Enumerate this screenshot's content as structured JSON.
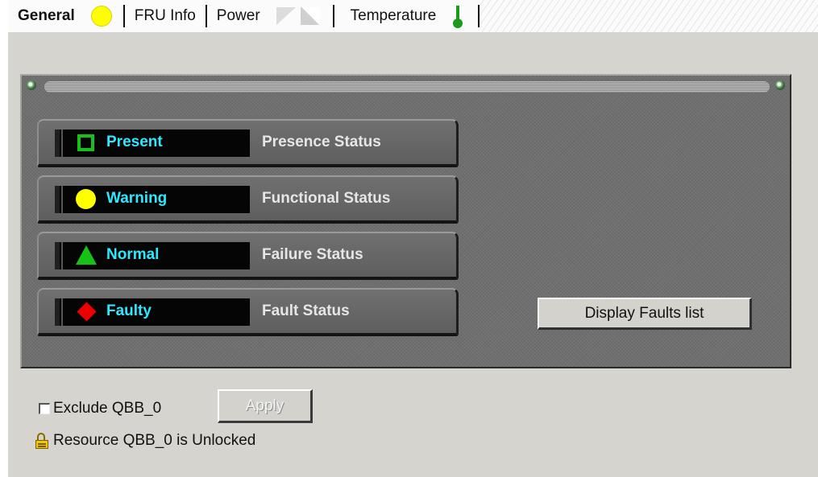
{
  "tabs": [
    {
      "label": "General",
      "icon": "status-warning-circle-icon",
      "active": true
    },
    {
      "label": "FRU Info"
    },
    {
      "label": "Power",
      "icon": "power-icon"
    },
    {
      "label": "Temperature",
      "icon": "thermometer-icon"
    }
  ],
  "panel": {
    "statuses": [
      {
        "value": "Present",
        "label": "Presence Status",
        "symbol": "green-square-icon",
        "color": "#15c215"
      },
      {
        "value": "Warning",
        "label": "Functional Status",
        "symbol": "yellow-circle-icon",
        "color": "#ffff00"
      },
      {
        "value": "Normal",
        "label": "Failure Status",
        "symbol": "green-triangle-icon",
        "color": "#15c215"
      },
      {
        "value": "Faulty",
        "label": "Fault Status",
        "symbol": "red-diamond-icon",
        "color": "#ee0000"
      }
    ],
    "faults_button": "Display Faults list"
  },
  "exclude": {
    "label": "Exclude QBB_0",
    "checked": false
  },
  "apply_button": "Apply",
  "lock_status": "Resource QBB_0 is Unlocked",
  "colors": {
    "status_text": "#2ee8ff",
    "panel_bg": "#6f6f6f",
    "page_bg": "#d6d4ce"
  }
}
